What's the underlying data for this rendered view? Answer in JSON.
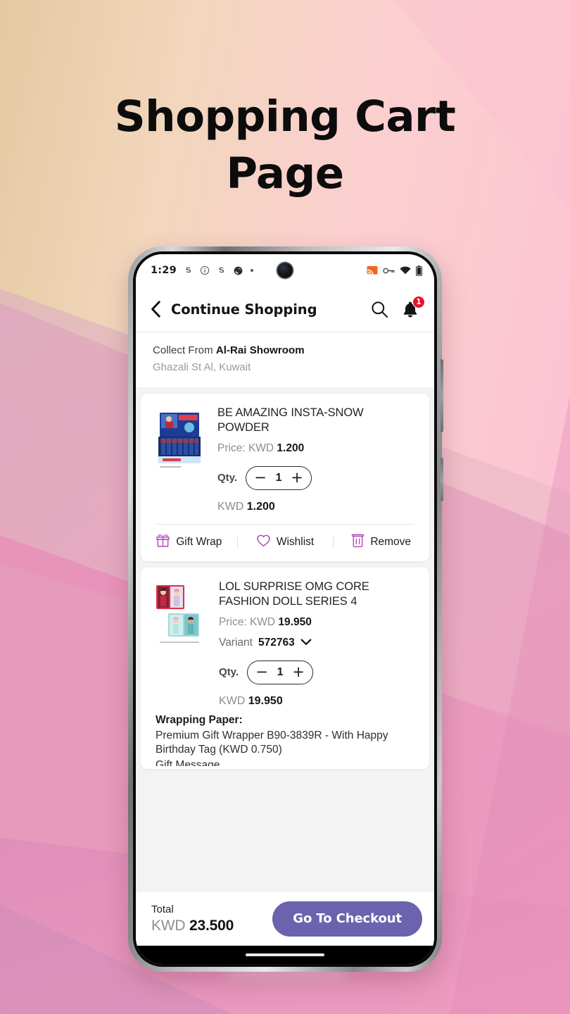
{
  "page": {
    "title_lines": [
      "Shopping Cart",
      "Page"
    ],
    "background": {
      "color_top_left": "#e7cfa7",
      "color_top_right": "#fbc5d2",
      "color_bottom": "#e88dba",
      "accent_band": "#d9a8c2"
    }
  },
  "statusbar": {
    "time": "1:29",
    "left_icons": [
      "skype-icon",
      "info-circle-icon",
      "skype-icon",
      "sync-icon",
      "dot-icon"
    ],
    "right_icons": [
      "cast-icon",
      "vpn-key-icon",
      "wifi-icon",
      "battery-icon"
    ]
  },
  "header": {
    "back_icon": "chevron-left-icon",
    "title": "Continue Shopping",
    "search_icon": "search-icon",
    "bell_icon": "bell-icon",
    "badge_count": "1"
  },
  "pickup": {
    "prefix": "Collect From ",
    "store": "Al-Rai Showroom",
    "address": "Ghazali St Al, Kuwait"
  },
  "cart": {
    "items": [
      {
        "name": "BE AMAZING INSTA-SNOW POWDER",
        "price_label": "Price:",
        "currency": "KWD",
        "price": "1.200",
        "qty_label": "Qty.",
        "qty": "1",
        "minus": "−",
        "plus": "+",
        "line_total_currency": "KWD",
        "line_total": "1.200",
        "thumb": "insta-snow-display-box",
        "actions": [
          {
            "icon": "gift-wrap-icon",
            "label": "Gift Wrap"
          },
          {
            "icon": "heart-icon",
            "label": "Wishlist"
          },
          {
            "icon": "trash-icon",
            "label": "Remove"
          }
        ]
      },
      {
        "name": "LOL SURPRISE OMG CORE FASHION DOLL SERIES 4",
        "price_label": "Price:",
        "currency": "KWD",
        "price": "19.950",
        "variant_label": "Variant",
        "variant_value": "572763",
        "variant_icon": "chevron-down-icon",
        "qty_label": "Qty.",
        "qty": "1",
        "minus": "−",
        "plus": "+",
        "line_total_currency": "KWD",
        "line_total": "19.950",
        "thumb": "lol-surprise-doll-boxes",
        "wrapping": {
          "title": "Wrapping Paper:",
          "description": "Premium Gift Wrapper B90-3839R -  With Happy Birthday Tag (KWD 0.750)",
          "cut_off_line": "Gift Message"
        }
      }
    ]
  },
  "bottom_bar": {
    "total_label": "Total",
    "total_currency": "KWD",
    "total_amount": "23.500",
    "checkout_label": "Go To Checkout",
    "accent_color": "#6b63ae"
  }
}
